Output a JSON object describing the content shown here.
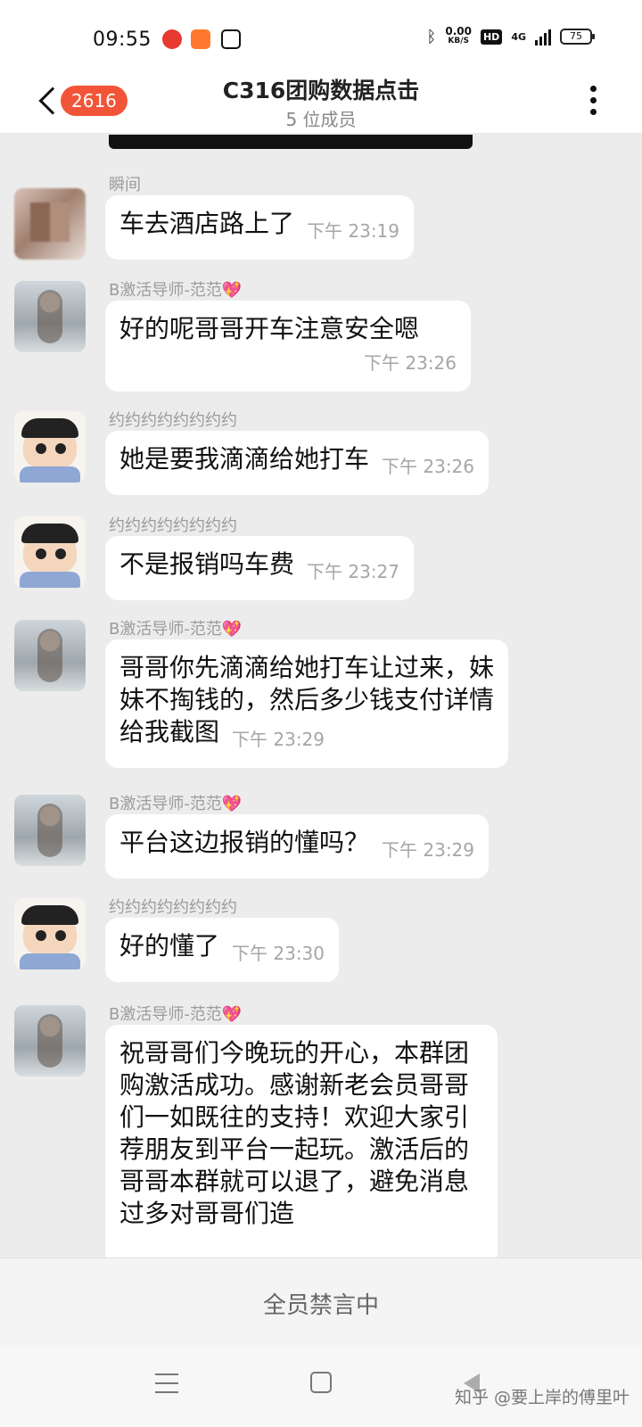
{
  "status_bar": {
    "time": "09:55",
    "net_speed_value": "0.00",
    "net_speed_unit": "KB/S",
    "hd": "HD",
    "network": "4G",
    "battery": "75",
    "icons": [
      "app-red-icon",
      "app-orange-icon",
      "tv-icon",
      "bluetooth-icon"
    ]
  },
  "header": {
    "unread_count": "2616",
    "title": "C316团购数据点击",
    "subtitle": "5 位成员"
  },
  "messages": [
    {
      "sender": "瞬间",
      "text": "车去酒店路上了",
      "meta": "下午  23:19"
    },
    {
      "sender": "B激活导师-范范💖",
      "text": "好的呢哥哥开车注意安全嗯",
      "meta": "下午  23:26"
    },
    {
      "sender": "约约约约约约约约",
      "text": "她是要我滴滴给她打车",
      "meta": "下午  23:26"
    },
    {
      "sender": "约约约约约约约约",
      "text": "不是报销吗车费",
      "meta": "下午  23:27"
    },
    {
      "sender": "B激活导师-范范💖",
      "text": "哥哥你先滴滴给她打车让过来，妹妹不掏钱的，然后多少钱支付详情给我截图",
      "meta": "下午  23:29"
    },
    {
      "sender": "B激活导师-范范💖",
      "text": "平台这边报销的懂吗？",
      "meta": "下午  23:29"
    },
    {
      "sender": "约约约约约约约约",
      "text": "好的懂了",
      "meta": "下午  23:30"
    },
    {
      "sender": "B激活导师-范范💖",
      "text": "祝哥哥们今晚玩的开心，本群团购激活成功。感谢新老会员哥哥们一如既往的支持！欢迎大家引荐朋友到平台一起玩。激活后的哥哥本群就可以退了，避免消息过多对哥哥们造",
      "meta": ""
    }
  ],
  "bottom": {
    "muted_text": "全员禁言中"
  },
  "watermark": "知乎 @要上岸的傅里叶",
  "colors": {
    "badge": "#f25438",
    "background": "#ececec",
    "bubble": "#ffffff"
  }
}
